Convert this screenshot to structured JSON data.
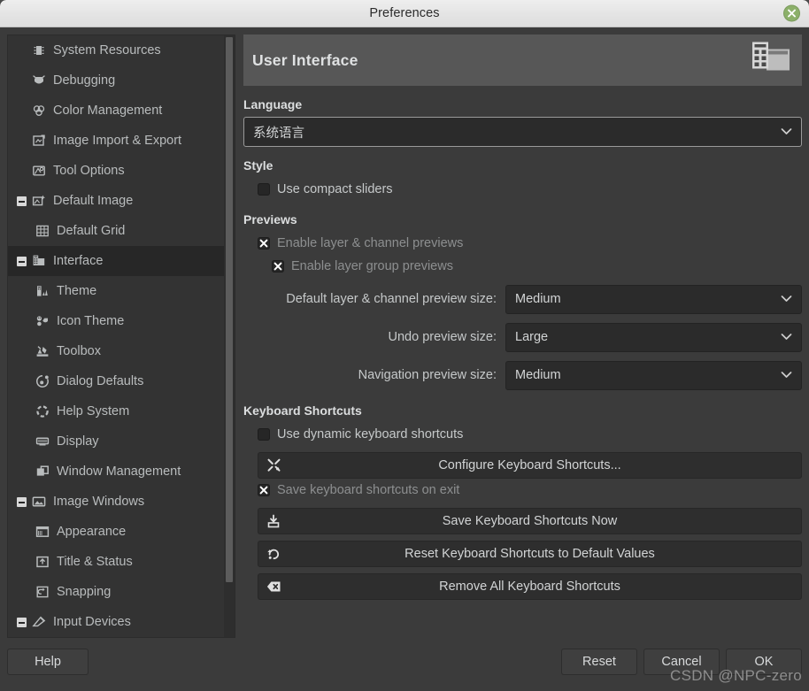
{
  "window": {
    "title": "Preferences",
    "close_icon": "close-circle-icon"
  },
  "sidebar": {
    "items": [
      {
        "label": "System Resources",
        "icon": "cpu-icon",
        "indent": 0,
        "expander": "none",
        "selected": false
      },
      {
        "label": "Debugging",
        "icon": "bug-icon",
        "indent": 0,
        "expander": "none",
        "selected": false
      },
      {
        "label": "Color Management",
        "icon": "color-wheel-icon",
        "indent": 0,
        "expander": "none",
        "selected": false
      },
      {
        "label": "Image Import & Export",
        "icon": "import-export-icon",
        "indent": 0,
        "expander": "none",
        "selected": false
      },
      {
        "label": "Tool Options",
        "icon": "tool-options-icon",
        "indent": 0,
        "expander": "none",
        "selected": false
      },
      {
        "label": "Default Image",
        "icon": "default-image-icon",
        "indent": 0,
        "expander": "minus",
        "selected": false
      },
      {
        "label": "Default Grid",
        "icon": "grid-icon",
        "indent": 1,
        "expander": "none",
        "selected": false
      },
      {
        "label": "Interface",
        "icon": "interface-icon",
        "indent": 0,
        "expander": "minus",
        "selected": true
      },
      {
        "label": "Theme",
        "icon": "theme-icon",
        "indent": 1,
        "expander": "none",
        "selected": false
      },
      {
        "label": "Icon Theme",
        "icon": "icon-theme-icon",
        "indent": 1,
        "expander": "none",
        "selected": false
      },
      {
        "label": "Toolbox",
        "icon": "toolbox-icon",
        "indent": 1,
        "expander": "none",
        "selected": false
      },
      {
        "label": "Dialog Defaults",
        "icon": "dialog-defaults-icon",
        "indent": 1,
        "expander": "none",
        "selected": false
      },
      {
        "label": "Help System",
        "icon": "help-system-icon",
        "indent": 1,
        "expander": "none",
        "selected": false
      },
      {
        "label": "Display",
        "icon": "display-icon",
        "indent": 1,
        "expander": "none",
        "selected": false
      },
      {
        "label": "Window Management",
        "icon": "window-management-icon",
        "indent": 1,
        "expander": "none",
        "selected": false
      },
      {
        "label": "Image Windows",
        "icon": "image-windows-icon",
        "indent": 0,
        "expander": "minus",
        "selected": false
      },
      {
        "label": "Appearance",
        "icon": "appearance-icon",
        "indent": 1,
        "expander": "none",
        "selected": false
      },
      {
        "label": "Title & Status",
        "icon": "title-status-icon",
        "indent": 1,
        "expander": "none",
        "selected": false
      },
      {
        "label": "Snapping",
        "icon": "snapping-icon",
        "indent": 1,
        "expander": "none",
        "selected": false
      },
      {
        "label": "Input Devices",
        "icon": "input-devices-icon",
        "indent": 0,
        "expander": "minus",
        "selected": false
      }
    ]
  },
  "page": {
    "title": "User Interface",
    "header_icon": "user-interface-icon",
    "language": {
      "section_label": "Language",
      "value": "系统语言"
    },
    "style": {
      "section_label": "Style",
      "compact_sliders": {
        "label": "Use compact sliders",
        "checked": false,
        "dimmed": false
      }
    },
    "previews": {
      "section_label": "Previews",
      "layer_channel": {
        "label": "Enable layer & channel previews",
        "checked": true,
        "dimmed": true
      },
      "layer_group": {
        "label": "Enable layer group previews",
        "checked": true,
        "dimmed": true
      },
      "combos": [
        {
          "label": "Default layer & channel preview size:",
          "value": "Medium"
        },
        {
          "label": "Undo preview size:",
          "value": "Large"
        },
        {
          "label": "Navigation preview size:",
          "value": "Medium"
        }
      ]
    },
    "shortcuts": {
      "section_label": "Keyboard Shortcuts",
      "dynamic": {
        "label": "Use dynamic keyboard shortcuts",
        "checked": false,
        "dimmed": false
      },
      "configure_button": {
        "label": "Configure Keyboard Shortcuts...",
        "icon": "wrench-screwdriver-icon"
      },
      "save_on_exit": {
        "label": "Save keyboard shortcuts on exit",
        "checked": true,
        "dimmed": true
      },
      "buttons": [
        {
          "label": "Save Keyboard Shortcuts Now",
          "icon": "save-icon"
        },
        {
          "label": "Reset Keyboard Shortcuts to Default Values",
          "icon": "revert-icon"
        },
        {
          "label": "Remove All Keyboard Shortcuts",
          "icon": "delete-icon"
        }
      ]
    }
  },
  "footer": {
    "help": "Help",
    "reset": "Reset",
    "cancel": "Cancel",
    "ok": "OK"
  },
  "watermark": "CSDN @NPC-zero",
  "colors": {
    "titlebar": "#e6e6e6",
    "window_bg": "#3b3b3b",
    "sidebar_bg": "#333333",
    "selected_row": "#272727",
    "header_bg": "#575757",
    "close_green": "#8cb06a",
    "text": "#c6c9ca",
    "text_dim": "#8d8f90"
  }
}
